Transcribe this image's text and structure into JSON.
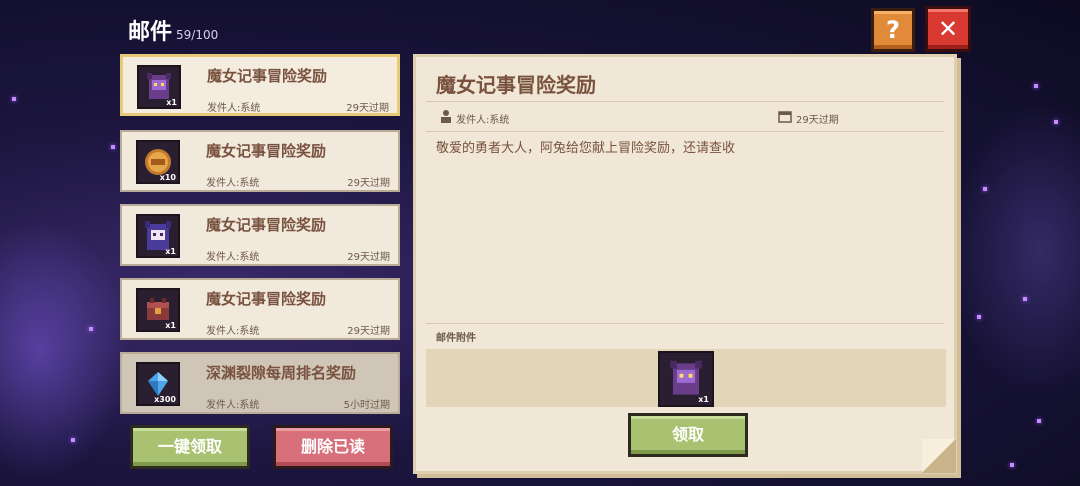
{
  "header": {
    "title": "邮件",
    "count": "59/100"
  },
  "controls": {
    "help_label": "?",
    "close_label": "✕"
  },
  "mail_list": [
    {
      "title": "魔女记事冒险奖励",
      "sender": "发件人:系统",
      "expire": "29天过期",
      "qty": "x1",
      "icon": "witch-avatar-icon"
    },
    {
      "title": "魔女记事冒险奖励",
      "sender": "发件人:系统",
      "expire": "29天过期",
      "qty": "x10",
      "icon": "gold-coin-icon"
    },
    {
      "title": "魔女记事冒险奖励",
      "sender": "发件人:系统",
      "expire": "29天过期",
      "qty": "x1",
      "icon": "witch-character-icon"
    },
    {
      "title": "魔女记事冒险奖励",
      "sender": "发件人:系统",
      "expire": "29天过期",
      "qty": "x1",
      "icon": "chest-icon"
    },
    {
      "title": "深渊裂隙每周排名奖励",
      "sender": "发件人:系统",
      "expire": "5小时过期",
      "qty": "x300",
      "icon": "diamond-icon"
    }
  ],
  "actions": {
    "claim_all": "一键领取",
    "delete_read": "删除已读"
  },
  "detail": {
    "title": "魔女记事冒险奖励",
    "sender": "发件人:系统",
    "expire": "29天过期",
    "body": "敬爱的勇者大人，阿兔给您献上冒险奖励，还请查收",
    "attachments_label": "邮件附件",
    "attachment_qty": "x1",
    "claim_label": "领取"
  },
  "colors": {
    "accent_green": "#a8c271",
    "accent_red": "#d7707a",
    "close_red": "#d83a32",
    "help_orange": "#e08a3a"
  }
}
